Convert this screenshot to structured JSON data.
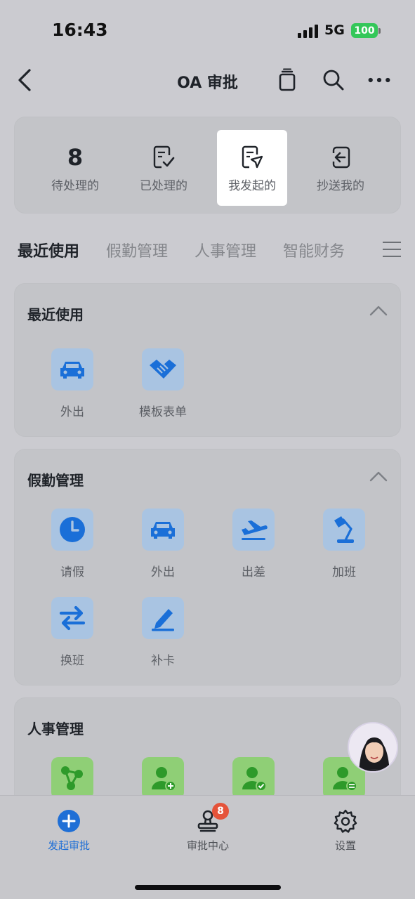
{
  "status_bar": {
    "time": "16:43",
    "network": "5G",
    "battery": "100"
  },
  "nav": {
    "title": "OA 审批"
  },
  "stats": [
    {
      "value": "8",
      "label": "待处理的"
    },
    {
      "label": "已处理的"
    },
    {
      "label": "我发起的"
    },
    {
      "label": "抄送我的"
    }
  ],
  "tabs": [
    "最近使用",
    "假勤管理",
    "人事管理",
    "智能财务"
  ],
  "recent": {
    "title": "最近使用",
    "apps": [
      {
        "label": "外出",
        "icon": "car-icon"
      },
      {
        "label": "模板表单",
        "icon": "handshake-icon"
      }
    ]
  },
  "attendance": {
    "title": "假勤管理",
    "apps": [
      {
        "label": "请假",
        "icon": "clock-icon"
      },
      {
        "label": "外出",
        "icon": "car-icon"
      },
      {
        "label": "出差",
        "icon": "airplane-icon"
      },
      {
        "label": "加班",
        "icon": "desk-lamp-icon"
      },
      {
        "label": "换班",
        "icon": "swap-icon"
      },
      {
        "label": "补卡",
        "icon": "pencil-icon"
      }
    ]
  },
  "hr": {
    "title": "人事管理",
    "apps": [
      {
        "icon": "org-structure-icon"
      },
      {
        "icon": "add-person-icon"
      },
      {
        "icon": "person-check-icon"
      },
      {
        "icon": "person-transfer-icon"
      }
    ]
  },
  "tabbar": [
    {
      "label": "发起审批",
      "icon": "plus-circle-icon"
    },
    {
      "label": "审批中心",
      "icon": "stamp-icon",
      "badge": "8"
    },
    {
      "label": "设置",
      "icon": "gear-icon"
    }
  ],
  "colors": {
    "accent": "#1f6fd6",
    "badge": "#e5533a",
    "blue_icon_bg": "#a9c4e2",
    "green_icon_bg": "#8fcf76"
  }
}
